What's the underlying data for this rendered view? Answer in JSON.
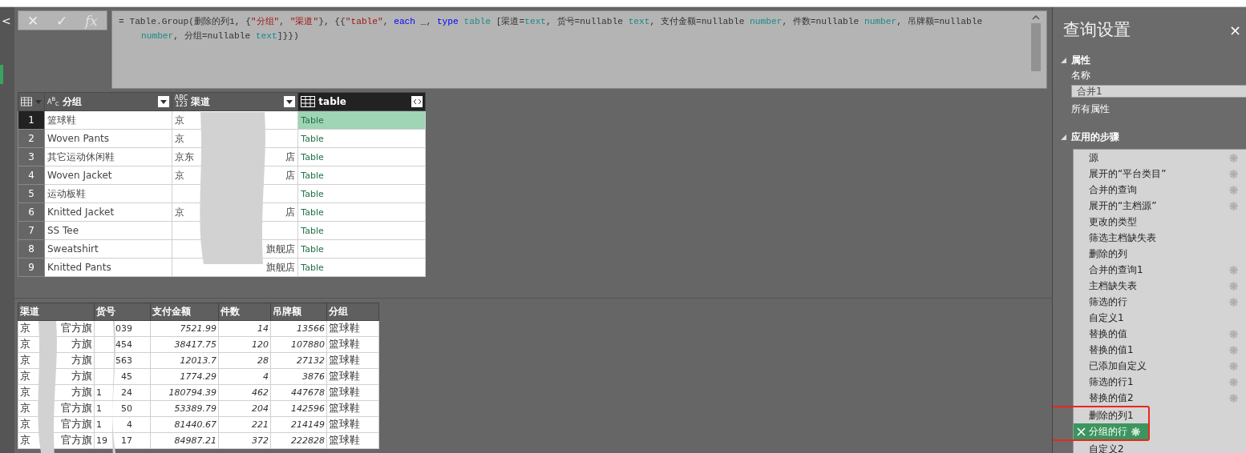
{
  "navigator": {
    "collapse": "<"
  },
  "formula_bar": {
    "cancel": "✕",
    "confirm": "✓",
    "fx": "fx",
    "lines": [
      [
        {
          "kind": "plain",
          "text": "= Table.Group(删除的列1, {"
        },
        {
          "kind": "string",
          "text": "\"分组\""
        },
        {
          "kind": "plain",
          "text": ", "
        },
        {
          "kind": "string",
          "text": "\"渠道\""
        },
        {
          "kind": "plain",
          "text": "}, {{"
        },
        {
          "kind": "string",
          "text": "\"table\""
        },
        {
          "kind": "plain",
          "text": ", "
        },
        {
          "kind": "keyword",
          "text": "each"
        },
        {
          "kind": "plain",
          "text": " _, "
        },
        {
          "kind": "keyword",
          "text": "type"
        },
        {
          "kind": "type",
          "text": " table"
        },
        {
          "kind": "plain",
          "text": " [渠道="
        },
        {
          "kind": "type",
          "text": "text"
        },
        {
          "kind": "plain",
          "text": ", 货号=nullable "
        },
        {
          "kind": "type",
          "text": "text"
        },
        {
          "kind": "plain",
          "text": ", 支付金额=nullable "
        },
        {
          "kind": "type",
          "text": "number"
        },
        {
          "kind": "plain",
          "text": ", 件数=nullable "
        },
        {
          "kind": "type",
          "text": "number"
        },
        {
          "kind": "plain",
          "text": ", 吊牌额=nullable"
        }
      ],
      [
        {
          "kind": "type",
          "text": "number"
        },
        {
          "kind": "plain",
          "text": ", 分组=nullable "
        },
        {
          "kind": "type",
          "text": "text"
        },
        {
          "kind": "plain",
          "text": "]}})"
        }
      ]
    ]
  },
  "grid": {
    "columns": [
      {
        "kind": "text",
        "type_label": "A$^{B}$$_{C}$",
        "title": "分组",
        "selected": false
      },
      {
        "kind": "any",
        "type_label": "ABC\n123",
        "title": "渠道",
        "selected": false
      },
      {
        "kind": "table",
        "title": "table",
        "selected": true
      }
    ],
    "rows": [
      {
        "number": "1",
        "group": "篮球鞋",
        "channel_head": "京",
        "value": "Table",
        "selected": true
      },
      {
        "number": "2",
        "group": "Woven Pants",
        "channel_head": "京",
        "value": "Table",
        "selected": false
      },
      {
        "number": "3",
        "group": "其它运动休闲鞋",
        "channel_head": "京东",
        "channel_tail": "店",
        "value": "Table",
        "selected": false
      },
      {
        "number": "4",
        "group": "Woven Jacket",
        "channel_head": "京",
        "channel_tail": "店",
        "value": "Table",
        "selected": false
      },
      {
        "number": "5",
        "group": "运动板鞋",
        "value": "Table",
        "selected": false
      },
      {
        "number": "6",
        "group": "Knitted Jacket",
        "channel_head": "京",
        "channel_tail": "店",
        "value": "Table",
        "selected": false
      },
      {
        "number": "7",
        "group": "SS Tee",
        "value": "Table",
        "selected": false
      },
      {
        "number": "8",
        "group": "Sweatshirt",
        "channel_tail": "旗舰店",
        "value": "Table",
        "selected": false
      },
      {
        "number": "9",
        "group": "Knitted Pants",
        "channel_tail": "旗舰店",
        "value": "Table",
        "selected": false
      }
    ]
  },
  "preview": {
    "columns": [
      "渠道",
      "货号",
      "支付金额",
      "件数",
      "吊牌额",
      "分组"
    ],
    "rows": [
      {
        "channel_head": "京",
        "channel_tail": "官方旗",
        "sku_tail": "039",
        "amount": "7521.99",
        "count": "14",
        "tag": "13566",
        "group": "篮球鞋"
      },
      {
        "channel_head": "京",
        "channel_tail": "方旗",
        "sku_tail": "454",
        "amount": "38417.75",
        "count": "120",
        "tag": "107880",
        "group": "篮球鞋"
      },
      {
        "channel_head": "京",
        "channel_tail": "方旗",
        "sku_tail": "563",
        "amount": "12013.7",
        "count": "28",
        "tag": "27132",
        "group": "篮球鞋"
      },
      {
        "channel_head": "京",
        "channel_tail": "方旗",
        "sku_tail": "45",
        "amount": "1774.29",
        "count": "4",
        "tag": "3876",
        "group": "篮球鞋"
      },
      {
        "channel_head": "京",
        "channel_tail": "方旗",
        "sku_head": "1",
        "sku_tail": "24",
        "amount": "180794.39",
        "count": "462",
        "tag": "447678",
        "group": "篮球鞋"
      },
      {
        "channel_head": "京",
        "channel_tail": "官方旗",
        "sku_head": "1",
        "sku_tail": "50",
        "amount": "53389.79",
        "count": "204",
        "tag": "142596",
        "group": "篮球鞋"
      },
      {
        "channel_head": "京",
        "channel_tail": "官方旗",
        "sku_head": "1",
        "sku_tail": "4",
        "amount": "81440.67",
        "count": "221",
        "tag": "214149",
        "group": "篮球鞋"
      },
      {
        "channel_head": "京",
        "channel_tail": "官方旗",
        "sku_head": "19",
        "sku_tail": "17",
        "amount": "84987.21",
        "count": "372",
        "tag": "222828",
        "group": "篮球鞋"
      }
    ]
  },
  "query_settings": {
    "title": "查询设置",
    "close": "×",
    "properties": {
      "heading": "属性",
      "name_label": "名称",
      "name_value": "合并1",
      "all_properties": "所有属性"
    },
    "steps_heading": "应用的步骤",
    "steps": [
      {
        "label": "源",
        "gear": true,
        "selected": false,
        "highlighted": false
      },
      {
        "label": "展开的“平台类目”",
        "gear": true,
        "selected": false,
        "highlighted": false
      },
      {
        "label": "合并的查询",
        "gear": true,
        "selected": false,
        "highlighted": false
      },
      {
        "label": "展开的“主档源”",
        "gear": true,
        "selected": false,
        "highlighted": false
      },
      {
        "label": "更改的类型",
        "gear": false,
        "selected": false,
        "highlighted": false
      },
      {
        "label": "筛选主档缺失表",
        "gear": false,
        "selected": false,
        "highlighted": false
      },
      {
        "label": "删除的列",
        "gear": false,
        "selected": false,
        "highlighted": false
      },
      {
        "label": "合并的查询1",
        "gear": true,
        "selected": false,
        "highlighted": false
      },
      {
        "label": "主档缺失表",
        "gear": true,
        "selected": false,
        "highlighted": false
      },
      {
        "label": "筛选的行",
        "gear": true,
        "selected": false,
        "highlighted": false
      },
      {
        "label": "自定义1",
        "gear": false,
        "selected": false,
        "highlighted": false
      },
      {
        "label": "替换的值",
        "gear": true,
        "selected": false,
        "highlighted": false
      },
      {
        "label": "替换的值1",
        "gear": true,
        "selected": false,
        "highlighted": false
      },
      {
        "label": "已添加自定义",
        "gear": true,
        "selected": false,
        "highlighted": false
      },
      {
        "label": "筛选的行1",
        "gear": true,
        "selected": false,
        "highlighted": false
      },
      {
        "label": "替换的值2",
        "gear": true,
        "selected": false,
        "highlighted": false
      },
      {
        "label": "删除的列1",
        "gear": false,
        "selected": false,
        "highlighted": true
      },
      {
        "label": "分组的行",
        "gear": true,
        "selected": true,
        "highlighted": true
      },
      {
        "label": "自定义2",
        "gear": false,
        "selected": false,
        "highlighted": false
      }
    ]
  }
}
